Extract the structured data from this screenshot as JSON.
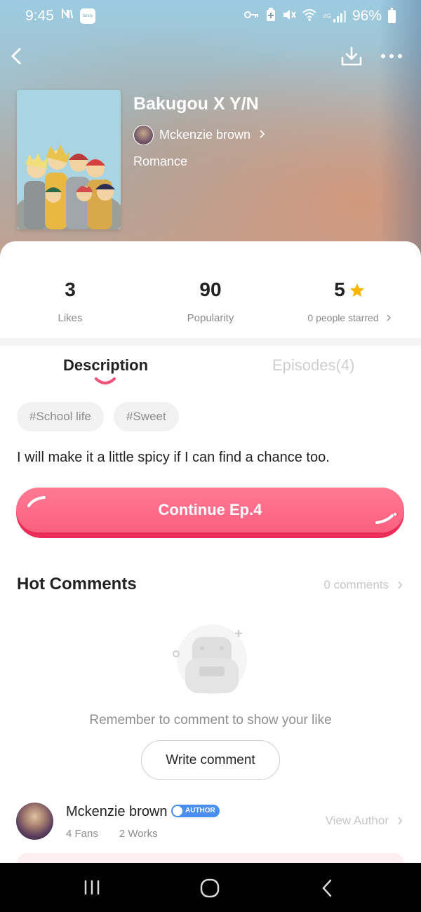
{
  "status_bar": {
    "time": "9:45",
    "battery": "96%",
    "network_label": "4G",
    "app_icon_label": "fandy",
    "icons": [
      "nfc-icon",
      "app-notification-icon",
      "vpn-key-icon",
      "battery-saver-icon",
      "mute-icon",
      "wifi-icon",
      "signal-icon",
      "battery-icon"
    ]
  },
  "nav": {
    "back_icon": "back-arrow-icon",
    "download_icon": "download-icon",
    "more_icon": "more-options-icon"
  },
  "book": {
    "title": "Bakugou X Y/N",
    "author": "Mckenzie brown",
    "genre": "Romance"
  },
  "stats": {
    "likes_value": "3",
    "likes_label": "Likes",
    "popularity_value": "90",
    "popularity_label": "Popularity",
    "rating_value": "5",
    "starred_label": "0 people starred"
  },
  "tabs": {
    "description": "Description",
    "episodes": "Episodes(4)"
  },
  "tags": [
    "#School life",
    "#Sweet"
  ],
  "description": "I will make it a little spicy if I can find a chance too.",
  "continue_button": "Continue Ep.4",
  "comments": {
    "title": "Hot Comments",
    "count_label": "0 comments",
    "empty_message": "Remember to comment to show your like",
    "write_button": "Write comment"
  },
  "author_card": {
    "name": "Mckenzie brown",
    "badge": "AUTHOR",
    "fans": "4 Fans",
    "works": "2 Works",
    "view_link": "View Author"
  },
  "colors": {
    "accent": "#fb5f80",
    "accent_dark": "#ea2d58",
    "star": "#f7b500",
    "badge": "#4a8ef2",
    "muted_text": "#8e8e8e"
  }
}
